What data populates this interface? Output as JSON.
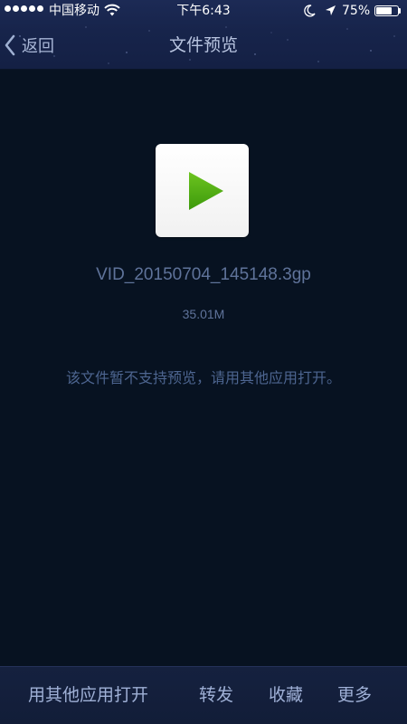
{
  "status_bar": {
    "carrier": "中国移动",
    "time": "下午6:43",
    "battery_percent": "75%",
    "battery_level": 0.75
  },
  "nav": {
    "back_label": "返回",
    "title": "文件预览"
  },
  "file": {
    "name": "VID_20150704_145148.3gp",
    "size": "35.01M",
    "icon": "play-icon",
    "accent_color": "#4caf13"
  },
  "notice": "该文件暂不支持预览，请用其他应用打开。",
  "toolbar": {
    "open_with_label": "用其他应用打开",
    "forward_label": "转发",
    "favorite_label": "收藏",
    "more_label": "更多"
  }
}
